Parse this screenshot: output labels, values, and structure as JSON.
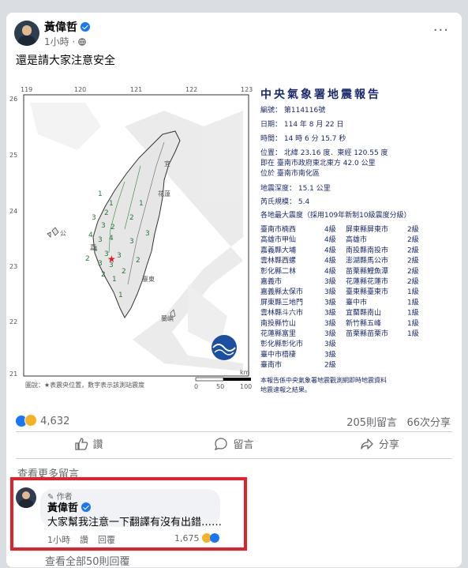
{
  "post": {
    "author": "黃偉哲",
    "time": "1小時 ·",
    "text": "還是請大家注意安全",
    "more": "···"
  },
  "report": {
    "title": "中央氣象署地震報告",
    "lines": [
      "編號： 第114116號",
      "日期： 114 年 8 月 22 日",
      "時間： 14 時 6 分 15.7 秒",
      "位置： 北緯 23.16 度．東經 120.55 度",
      "即在 臺南市政府東北東方 42.0 公里",
      "位於 臺南市南化區",
      "地震深度： 15.1 公里",
      "芮氏規模： 5.4",
      "各地最大震度（採用109年新制10級震度分級）"
    ],
    "intensity_left": [
      [
        "臺南市楠西",
        "4級"
      ],
      [
        "高雄市甲仙",
        "4級"
      ],
      [
        "嘉義縣大埔",
        "4級"
      ],
      [
        "雲林縣西螺",
        "4級"
      ],
      [
        "彰化縣二林",
        "4級"
      ],
      [
        "嘉義市",
        "3級"
      ],
      [
        "嘉義縣太保市",
        "3級"
      ],
      [
        "屏東縣三地門",
        "3級"
      ],
      [
        "雲林縣斗六市",
        "3級"
      ],
      [
        "南投縣竹山",
        "3級"
      ],
      [
        "花蓮縣富里",
        "3級"
      ],
      [
        "彰化縣彰化市",
        "3級"
      ],
      [
        "臺中市梧棲",
        "3級"
      ],
      [
        "臺南市",
        "2級"
      ]
    ],
    "intensity_right": [
      [
        "屏東縣屏東市",
        "2級"
      ],
      [
        "高雄市",
        "2級"
      ],
      [
        "南投縣南投市",
        "2級"
      ],
      [
        "澎湖縣馬公市",
        "2級"
      ],
      [
        "苗栗縣鯉魚潭",
        "2級"
      ],
      [
        "花蓮縣花蓮市",
        "2級"
      ],
      [
        "臺東縣臺東市",
        "1級"
      ],
      [
        "臺中市",
        "1級"
      ],
      [
        "宜蘭縣南山",
        "1級"
      ],
      [
        "新竹縣五峰",
        "1級"
      ],
      [
        "苗栗縣苗栗市",
        "1級"
      ]
    ],
    "footnote1": "本報告係中央氣象署地震觀測網即時地震資料",
    "footnote2": "地震速報之結果。",
    "legend": "圖說：★表震央位置，數字表示該測站震度",
    "lon_ticks": [
      "119",
      "120",
      "121",
      "122",
      "123"
    ],
    "lat_ticks": [
      "26",
      "25",
      "24",
      "23",
      "22",
      "21"
    ],
    "scale_ticks": [
      "0",
      "50",
      "100"
    ],
    "scale_unit": "km",
    "map_labels": [
      "公",
      "花蓮",
      "宜",
      "臺東",
      "蘭嶼",
      "嘉"
    ]
  },
  "reactions": {
    "count": "4,632"
  },
  "stats": {
    "comments": "205則留言",
    "shares": "66次分享"
  },
  "actions": {
    "like": "讚",
    "comment": "留言",
    "share": "分享"
  },
  "see_more_comments": "查看更多留言",
  "comment": {
    "badge": "作者",
    "author": "黃偉哲",
    "text": "大家幫我注意一下翻譯有沒有出錯……",
    "time": "1小時",
    "like": "讚",
    "reply": "回覆",
    "reactions": "1,675"
  },
  "see_all_replies": "查看全部50則回覆"
}
